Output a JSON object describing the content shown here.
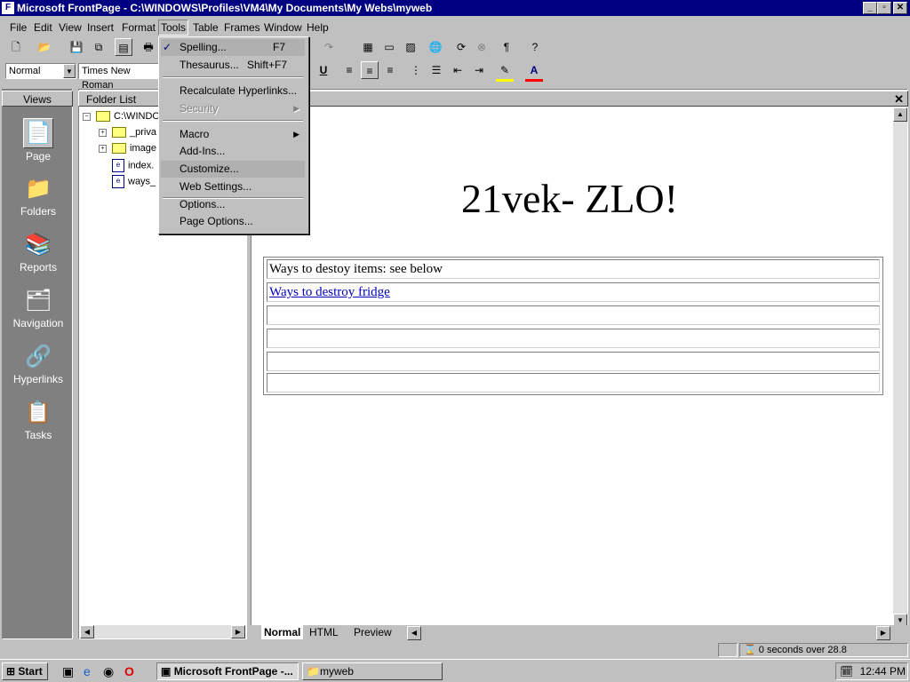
{
  "window": {
    "title": "Microsoft FrontPage - C:\\WINDOWS\\Profiles\\VM4\\My Documents\\My Webs\\myweb",
    "minimize": "_",
    "maximize": "▫",
    "close": "✕"
  },
  "menubar": [
    "File",
    "Edit",
    "View",
    "Insert",
    "Format",
    "Tools",
    "Table",
    "Frames",
    "Window",
    "Help"
  ],
  "format_toolbar": {
    "style_value": "Normal",
    "font_value": "Times New Roman"
  },
  "tools_menu": {
    "items": [
      {
        "label": "Spelling...",
        "accel": "F7"
      },
      {
        "label": "Thesaurus...",
        "accel": "Shift+F7"
      },
      {
        "label": "Recalculate Hyperlinks..."
      },
      {
        "label": "Security"
      },
      {
        "label": "Macro"
      },
      {
        "label": "Add-Ins..."
      },
      {
        "label": "Customize..."
      },
      {
        "label": "Web Settings..."
      },
      {
        "label": "Options..."
      },
      {
        "label": "Page Options..."
      }
    ]
  },
  "views": {
    "header": "Views",
    "items": [
      "Page",
      "Folders",
      "Reports",
      "Navigation",
      "Hyperlinks",
      "Tasks"
    ]
  },
  "folder_list": {
    "header": "Folder List",
    "root": "C:\\WINDO",
    "items": [
      "_priva",
      "image",
      "index.",
      "ways_"
    ]
  },
  "document": {
    "heading": "21vek- ZLO!",
    "rows": [
      "Ways to destoy items: see below",
      "Ways to destroy fridge",
      "",
      "",
      "",
      ""
    ]
  },
  "page_tabs": [
    "Normal",
    "HTML",
    "Preview"
  ],
  "status": {
    "download_time": "0 seconds over 28.8"
  },
  "taskbar": {
    "start": "Start",
    "tasks": [
      "Microsoft FrontPage -...",
      "myweb"
    ],
    "clock": "12:44 PM"
  }
}
